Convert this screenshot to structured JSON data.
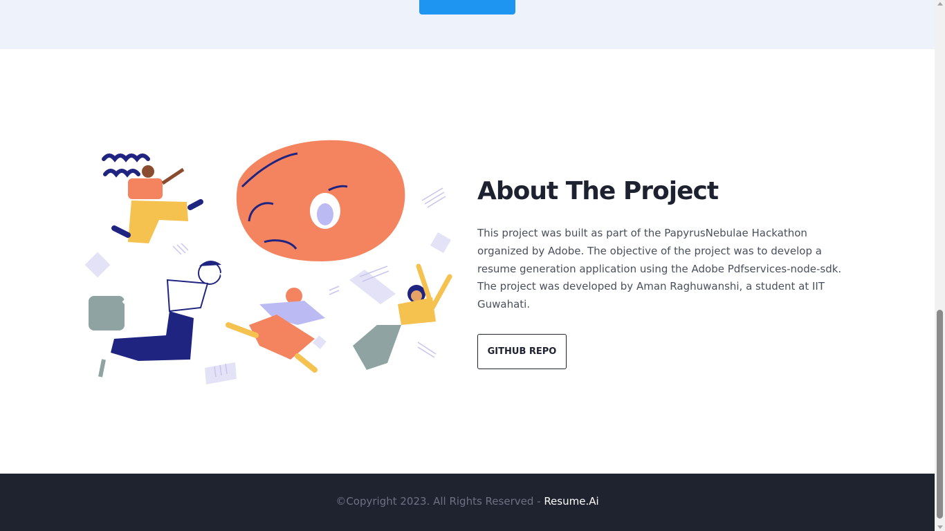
{
  "top_section": {
    "cta_label": ""
  },
  "about": {
    "title": "About The Project",
    "description": "This project was built as part of the PapyrusNebulae Hackathon organized by Adobe. The objective of the project was to develop a resume generation application using the Adobe Pdfservices-node-sdk. The project was developed by Aman Raghuwanshi, a student at IIT Guwahati.",
    "github_button": "GITHUB REPO",
    "illustration_icon": "people-running-with-giant-hand-illustration"
  },
  "footer": {
    "copyright": "©Copyright 2023. All Rights Reserved - ",
    "brand": "Resume.Ai"
  },
  "colors": {
    "accent_blue": "#1e95f0",
    "top_band": "#eef2fa",
    "footer_bg": "#1f2330",
    "title": "#1e2230",
    "body_text": "#4a4f5c",
    "illustration_orange": "#f4845f",
    "illustration_navy": "#1f2480",
    "illustration_yellow": "#f5c14f",
    "illustration_lavender": "#bcbaf2"
  }
}
